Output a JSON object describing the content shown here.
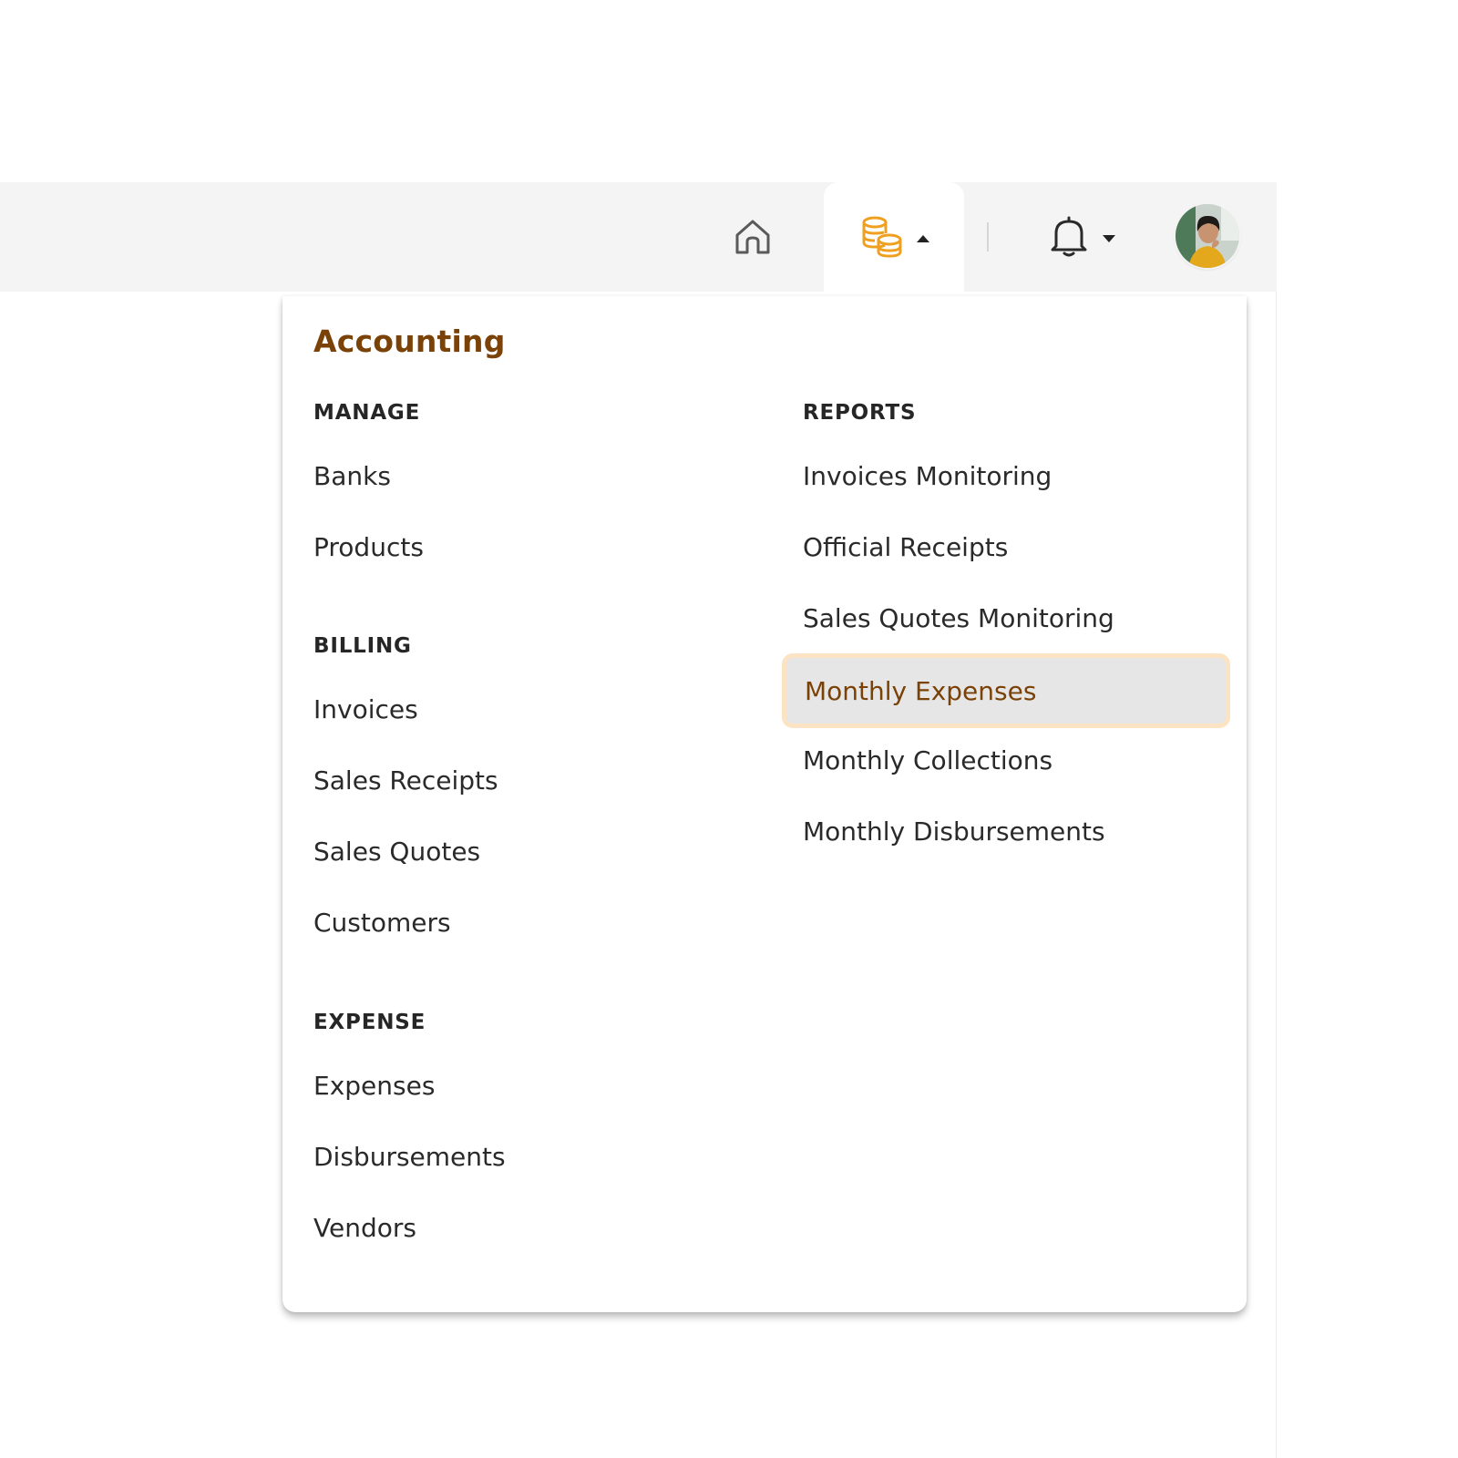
{
  "topbar": {
    "home_icon": "home-icon",
    "accounting_icon": "coins-stack-icon",
    "notifications_icon": "bell-icon",
    "accent_color": "#f0a020"
  },
  "dropdown": {
    "title": "Accounting",
    "manage": {
      "heading": "MANAGE",
      "items": [
        "Banks",
        "Products"
      ]
    },
    "billing": {
      "heading": "BILLING",
      "items": [
        "Invoices",
        "Sales Receipts",
        "Sales Quotes",
        "Customers"
      ]
    },
    "expense": {
      "heading": "EXPENSE",
      "items": [
        "Expenses",
        "Disbursements",
        "Vendors"
      ]
    },
    "reports": {
      "heading": "REPORTS",
      "items": [
        "Invoices Monitoring",
        "Official Receipts",
        "Sales Quotes Monitoring",
        "Monthly Expenses",
        "Monthly Collections",
        "Monthly Disbursements"
      ],
      "selected": "Monthly Expenses"
    },
    "title_color": "#7a4207",
    "highlight_border_color": "#fbe3c3"
  }
}
